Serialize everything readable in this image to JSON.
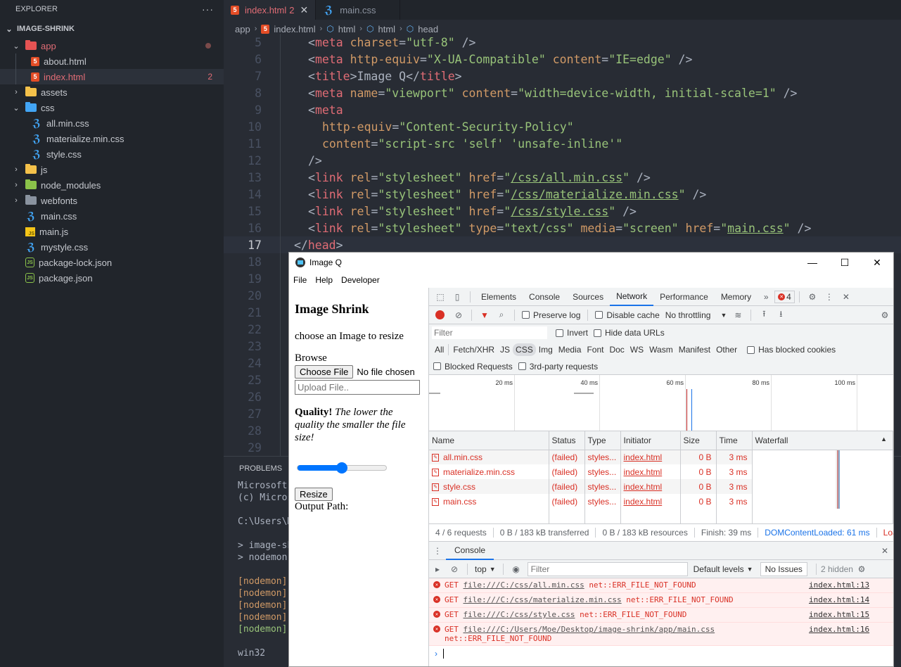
{
  "sidebar": {
    "header": "EXPLORER",
    "more": "···",
    "project": "IMAGE-SHRINK",
    "tree": {
      "app": "app",
      "about": "about.html",
      "index": "index.html",
      "index_badge": "2",
      "assets": "assets",
      "css": "css",
      "all_min": "all.min.css",
      "materialize": "materialize.min.css",
      "style": "style.css",
      "js": "js",
      "node_modules": "node_modules",
      "webfonts": "webfonts",
      "main_css": "main.css",
      "main_js": "main.js",
      "mystyle": "mystyle.css",
      "package_lock": "package-lock.json",
      "package": "package.json"
    }
  },
  "editor": {
    "tabs": [
      {
        "label": "index.html",
        "badge": "2",
        "close": "✕"
      },
      {
        "label": "main.css"
      }
    ],
    "breadcrumb": [
      "app",
      "index.html",
      "html",
      "html",
      "head"
    ],
    "lines": {
      "n5": "5",
      "n6": "6",
      "n7": "7",
      "n8": "8",
      "n9": "9",
      "n10": "10",
      "n11": "11",
      "n12": "12",
      "n13": "13",
      "n14": "14",
      "n15": "15",
      "n16": "16",
      "n17": "17",
      "n18": "18",
      "n19": "19",
      "n20": "20",
      "n21": "21",
      "n22": "22",
      "n23": "23",
      "n24": "24",
      "n25": "25",
      "n26": "26",
      "n27": "27",
      "n28": "28",
      "n29": "29"
    },
    "code": {
      "l5": {
        "tag": "meta",
        "a1": "charset",
        "v1": "\"utf-8\""
      },
      "l6": {
        "tag": "meta",
        "a1": "http-equiv",
        "v1": "\"X-UA-Compatible\"",
        "a2": "content",
        "v2": "\"IE=edge\""
      },
      "l7": {
        "tag": "title",
        "text": "Image Q"
      },
      "l8": {
        "tag": "meta",
        "a1": "name",
        "v1": "\"viewport\"",
        "a2": "content",
        "v2": "\"width=device-width, initial-scale=1\""
      },
      "l9": {
        "tag": "meta"
      },
      "l10": {
        "a1": "http-equiv",
        "v1": "\"Content-Security-Policy\""
      },
      "l11": {
        "a1": "content",
        "v1": "\"script-src 'self' 'unsafe-inline'\""
      },
      "l12": {
        "close": "/>"
      },
      "l13": {
        "tag": "link",
        "a1": "rel",
        "v1": "\"stylesheet\"",
        "a2": "href",
        "v2": "/css/all.min.css"
      },
      "l14": {
        "tag": "link",
        "a1": "rel",
        "v1": "\"stylesheet\"",
        "a2": "href",
        "v2": "/css/materialize.min.css"
      },
      "l15": {
        "tag": "link",
        "a1": "rel",
        "v1": "\"stylesheet\"",
        "a2": "href",
        "v2": "/css/style.css"
      },
      "l16": {
        "tag": "link",
        "a1": "rel",
        "v1": "\"stylesheet\"",
        "a2": "type",
        "v2": "\"text/css\"",
        "a3": "media",
        "v3": "\"screen\"",
        "a4": "href",
        "v4": "main.css"
      },
      "l17": {
        "tag": "head"
      }
    }
  },
  "panel": {
    "tab": "PROBLEMS",
    "terminal": {
      "t1": "Microsoft Windows",
      "t2": "(c) Microsoft Corporation",
      "t3": "C:\\Users\\Moe",
      "t4": "> image-shrink",
      "t5": "> nodemon",
      "t6": "[nodemon] 2",
      "t7": "[nodemon] t",
      "t8": "[nodemon] w",
      "t9": "[nodemon] w",
      "t10": "[nodemon] s",
      "t11": "win32"
    }
  },
  "app": {
    "title": "Image Q",
    "menu": [
      "File",
      "Help",
      "Developer"
    ],
    "page": {
      "heading": "Image Shrink",
      "subtitle": "choose an Image to resize",
      "browse": "Browse",
      "choose_file": "Choose File",
      "no_file": "No file chosen",
      "upload_placeholder": "Upload File..",
      "quality_bold": "Quality!",
      "quality_italic": "The lower the quality the smaller the file size!",
      "quality_value_percent": 50,
      "resize": "Resize",
      "output_path": "Output Path:"
    }
  },
  "devtools": {
    "tabs": [
      "Elements",
      "Console",
      "Sources",
      "Network",
      "Performance",
      "Memory"
    ],
    "active_tab": "Network",
    "more_tabs": "»",
    "error_count": "4",
    "toolbar": {
      "preserve_log": "Preserve log",
      "disable_cache": "Disable cache",
      "throttling": "No throttling"
    },
    "filter": {
      "placeholder": "Filter",
      "invert": "Invert",
      "hide_data_urls": "Hide data URLs"
    },
    "types": [
      "All",
      "Fetch/XHR",
      "JS",
      "CSS",
      "Img",
      "Media",
      "Font",
      "Doc",
      "WS",
      "Wasm",
      "Manifest",
      "Other"
    ],
    "active_type": "CSS",
    "has_blocked_cookies": "Has blocked cookies",
    "blocked_requests": "Blocked Requests",
    "third_party": "3rd-party requests",
    "overview_ticks": [
      "20 ms",
      "40 ms",
      "60 ms",
      "80 ms",
      "100 ms"
    ],
    "columns": [
      "Name",
      "Status",
      "Type",
      "Initiator",
      "Size",
      "Time",
      "Waterfall"
    ],
    "requests": [
      {
        "name": "all.min.css",
        "status": "(failed)",
        "type": "styles...",
        "initiator": "index.html",
        "size": "0 B",
        "time": "3 ms"
      },
      {
        "name": "materialize.min.css",
        "status": "(failed)",
        "type": "styles...",
        "initiator": "index.html",
        "size": "0 B",
        "time": "3 ms"
      },
      {
        "name": "style.css",
        "status": "(failed)",
        "type": "styles...",
        "initiator": "index.html",
        "size": "0 B",
        "time": "3 ms"
      },
      {
        "name": "main.css",
        "status": "(failed)",
        "type": "styles...",
        "initiator": "index.html",
        "size": "0 B",
        "time": "3 ms"
      }
    ],
    "summary": {
      "requests": "4 / 6 requests",
      "transferred": "0 B / 183 kB transferred",
      "resources": "0 B / 183 kB resources",
      "finish": "Finish: 39 ms",
      "dcl": "DOMContentLoaded: 61 ms",
      "load": "Load"
    },
    "console": {
      "tab": "Console",
      "context": "top",
      "filter_placeholder": "Filter",
      "levels": "Default levels",
      "issues": "No Issues",
      "hidden": "2 hidden",
      "messages": [
        {
          "method": "GET",
          "url": "file:///C:/css/all.min.css",
          "error": "net::ERR_FILE_NOT_FOUND",
          "source": "index.html:13"
        },
        {
          "method": "GET",
          "url": "file:///C:/css/materialize.min.css",
          "error": "net::ERR_FILE_NOT_FOUND",
          "source": "index.html:14"
        },
        {
          "method": "GET",
          "url": "file:///C:/css/style.css",
          "error": "net::ERR_FILE_NOT_FOUND",
          "source": "index.html:15"
        },
        {
          "method": "GET",
          "url": "file:///C:/Users/Moe/Desktop/image-shrink/app/main.css",
          "error": "net::ERR_FILE_NOT_FOUND",
          "source": "index.html:16"
        }
      ],
      "prompt": "›"
    }
  }
}
